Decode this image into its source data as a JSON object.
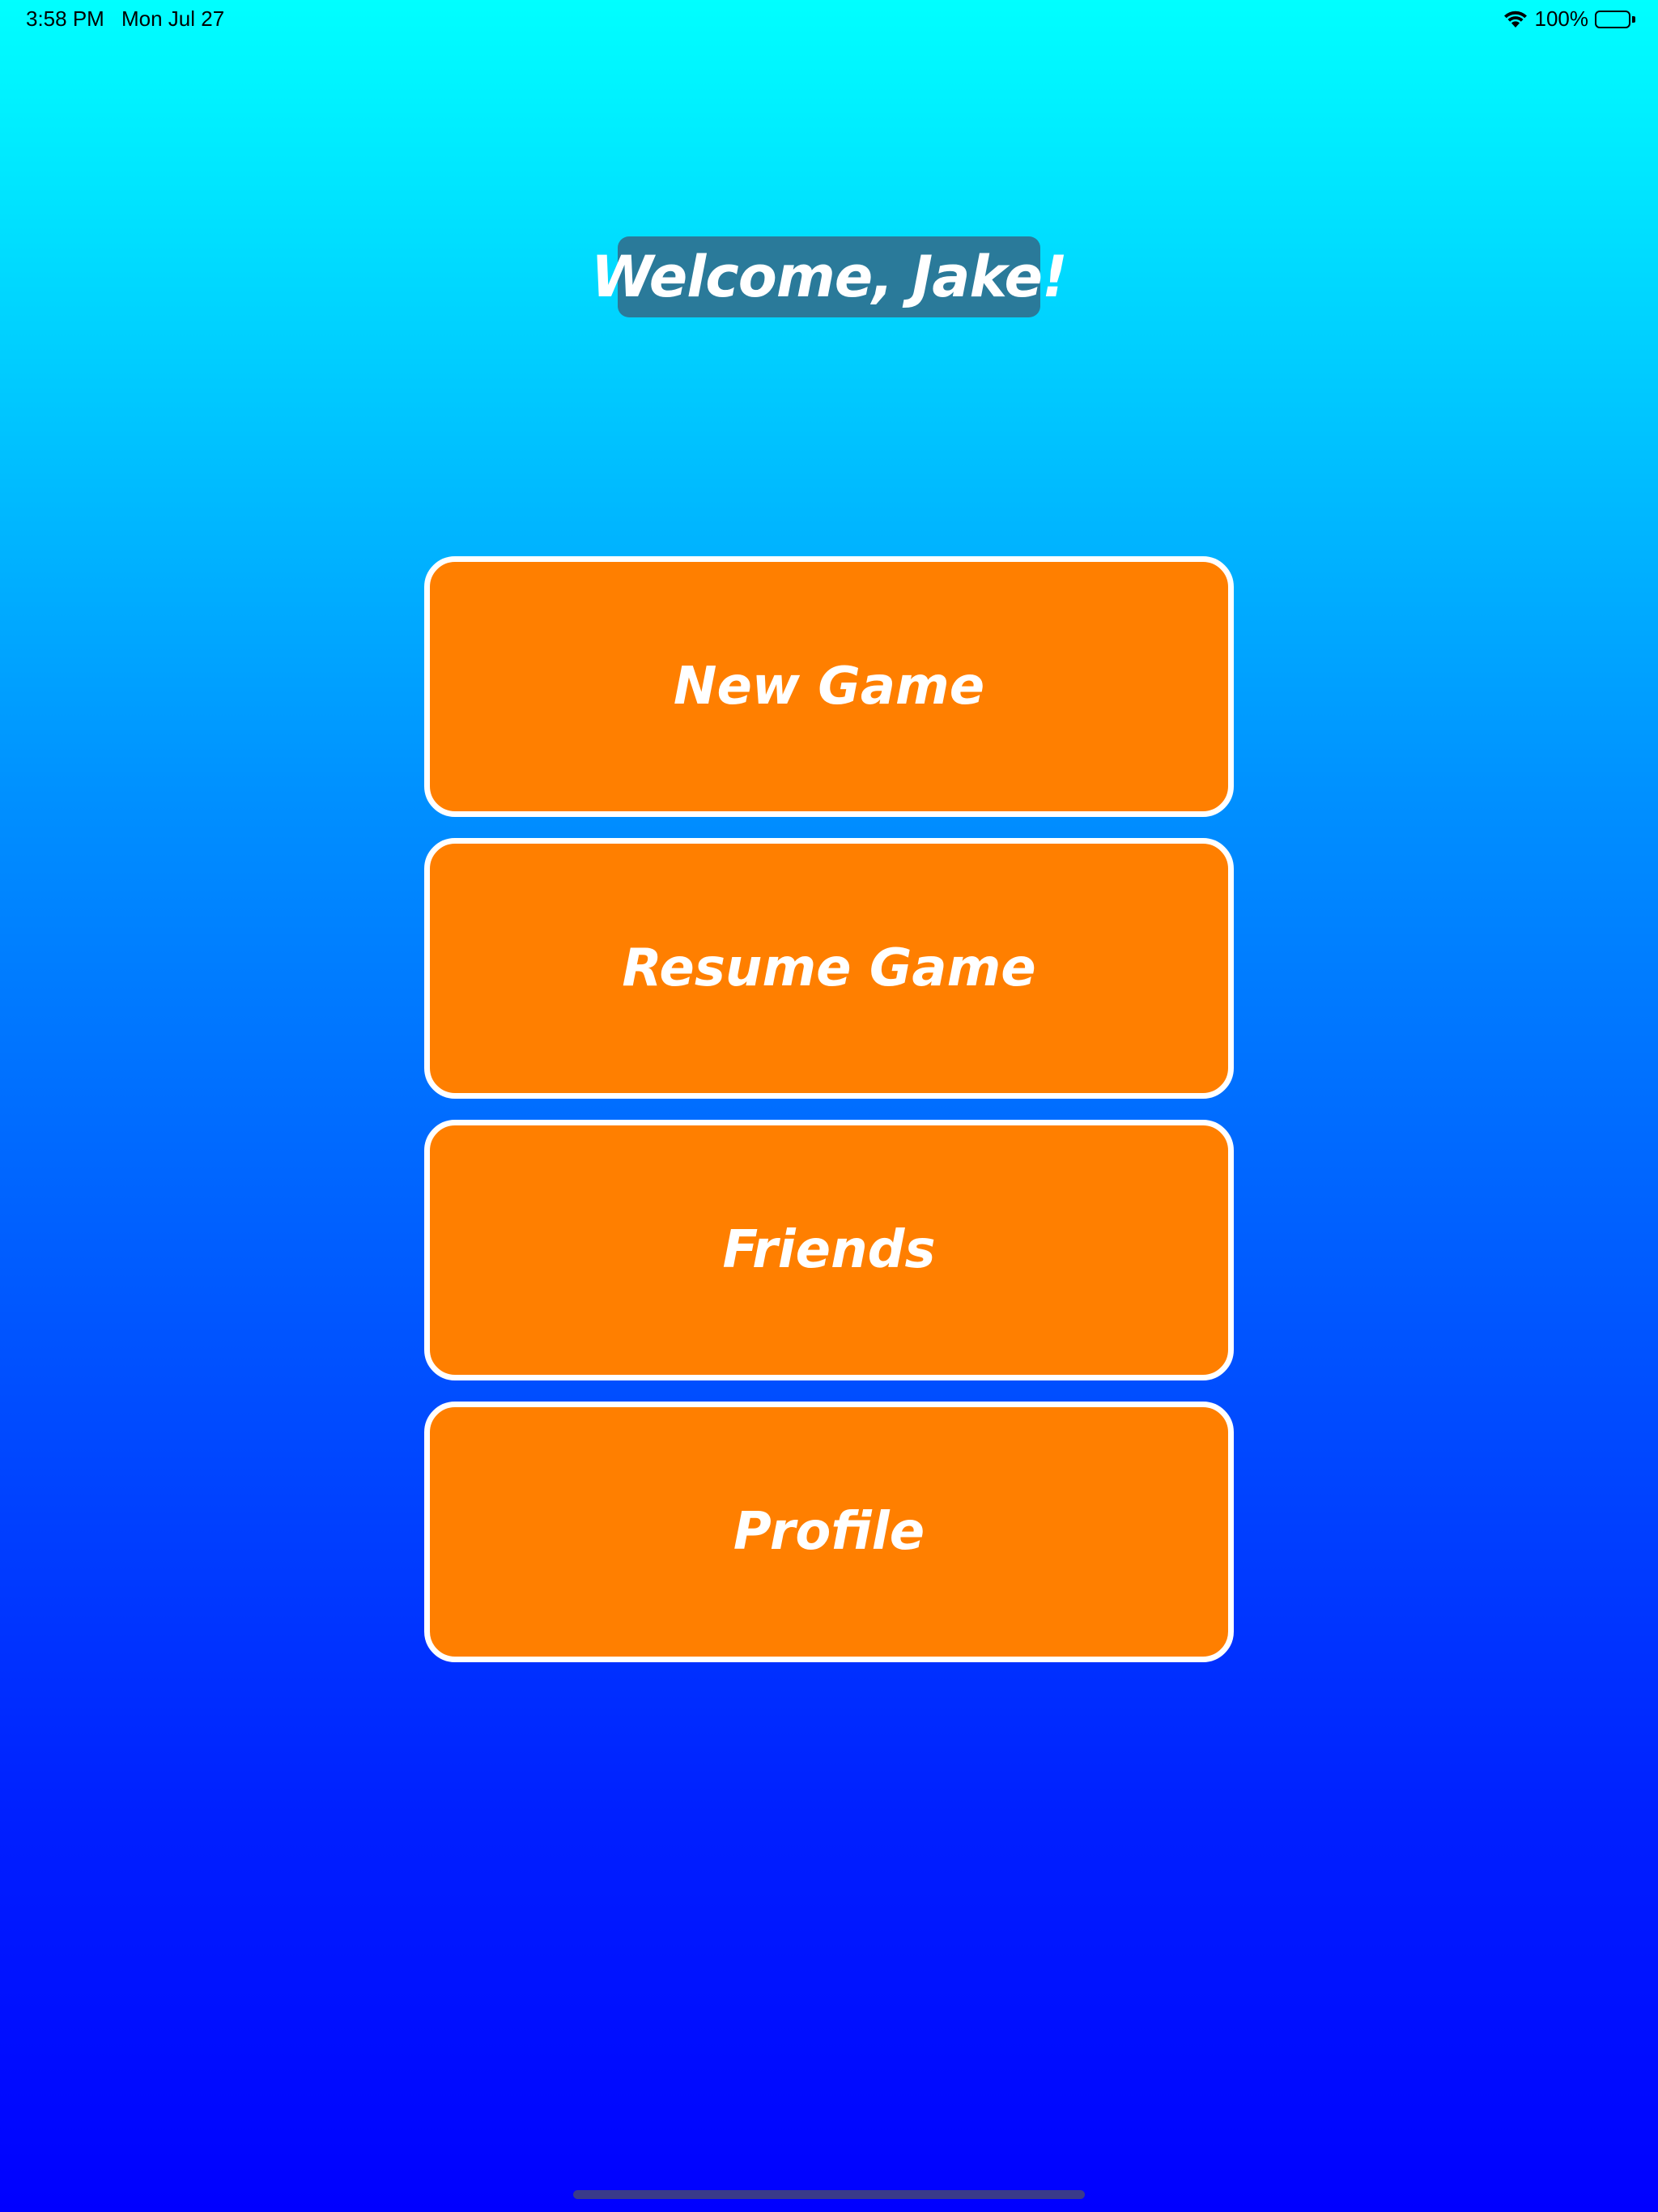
{
  "status_bar": {
    "time": "3:58 PM",
    "date": "Mon Jul 27",
    "battery": "100%",
    "wifi_icon": "wifi-icon",
    "battery_icon": "battery-icon"
  },
  "welcome": {
    "text": "Welcome, Jake!"
  },
  "menu": {
    "items": [
      {
        "label": "New Game"
      },
      {
        "label": "Resume Game"
      },
      {
        "label": "Friends"
      },
      {
        "label": "Profile"
      }
    ]
  },
  "colors": {
    "gradient_top": "#00ffff",
    "gradient_bottom": "#0000ff",
    "button_fill": "#ff7f00",
    "button_border": "#ffffff",
    "banner_fill": "#2a7a9a"
  }
}
